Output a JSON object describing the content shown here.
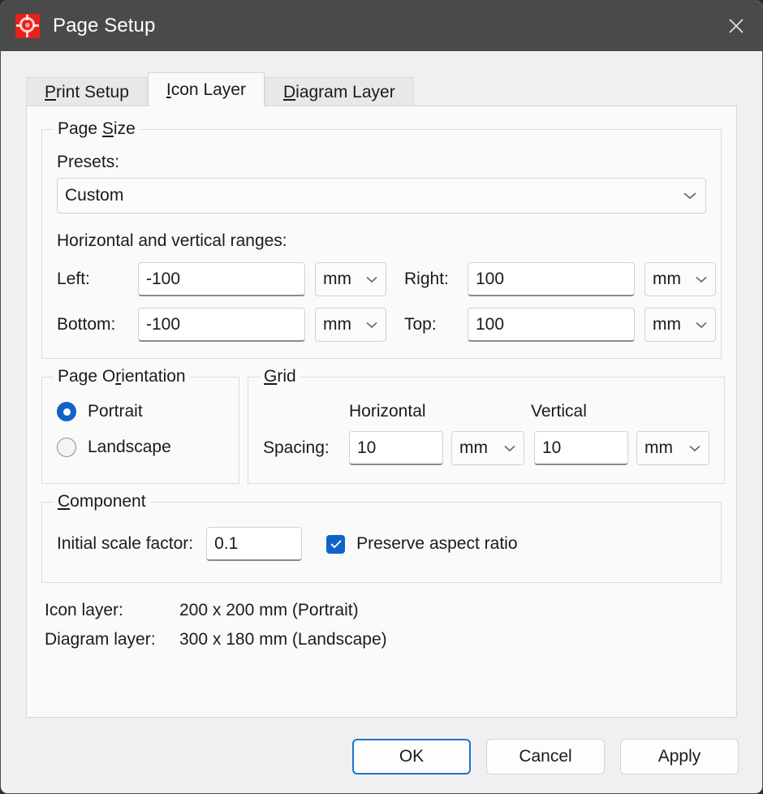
{
  "window": {
    "title": "Page Setup",
    "app_icon": "app-gear-icon",
    "close_icon": "close-icon",
    "accent_color": "#0f63c8",
    "titlebar_color": "#4a4a4a",
    "app_icon_color": "#e8201a"
  },
  "tabs": [
    {
      "label": "Print Setup",
      "accel": "P",
      "selected": false
    },
    {
      "label": "Icon Layer",
      "accel": "I",
      "selected": true
    },
    {
      "label": "Diagram Layer",
      "accel": "D",
      "selected": false
    }
  ],
  "page_size": {
    "legend": "Page Size",
    "legend_accel": "S",
    "presets_label": "Presets:",
    "presets_value": "Custom",
    "ranges_label": "Horizontal and vertical ranges:",
    "fields": [
      {
        "label": "Left:",
        "value": "-100",
        "unit": "mm"
      },
      {
        "label": "Right:",
        "value": "100",
        "unit": "mm"
      },
      {
        "label": "Bottom:",
        "value": "-100",
        "unit": "mm"
      },
      {
        "label": "Top:",
        "value": "100",
        "unit": "mm"
      }
    ]
  },
  "page_orientation": {
    "legend": "Page Orientation",
    "legend_accel": "r",
    "options": [
      {
        "label": "Portrait",
        "selected": true
      },
      {
        "label": "Landscape",
        "selected": false
      }
    ]
  },
  "grid": {
    "legend": "Grid",
    "legend_accel": "G",
    "col_horizontal": "Horizontal",
    "col_vertical": "Vertical",
    "spacing_label": "Spacing:",
    "horizontal_value": "10",
    "horizontal_unit": "mm",
    "vertical_value": "10",
    "vertical_unit": "mm"
  },
  "component": {
    "legend": "Component",
    "legend_accel": "C",
    "scale_label": "Initial scale factor:",
    "scale_value": "0.1",
    "preserve_label": "Preserve aspect ratio",
    "preserve_checked": true
  },
  "info": [
    {
      "key": "Icon layer:",
      "value": "200 x 200 mm (Portrait)"
    },
    {
      "key": "Diagram layer:",
      "value": "300 x 180 mm (Landscape)"
    }
  ],
  "footer": {
    "ok": "OK",
    "cancel": "Cancel",
    "apply": "Apply"
  }
}
